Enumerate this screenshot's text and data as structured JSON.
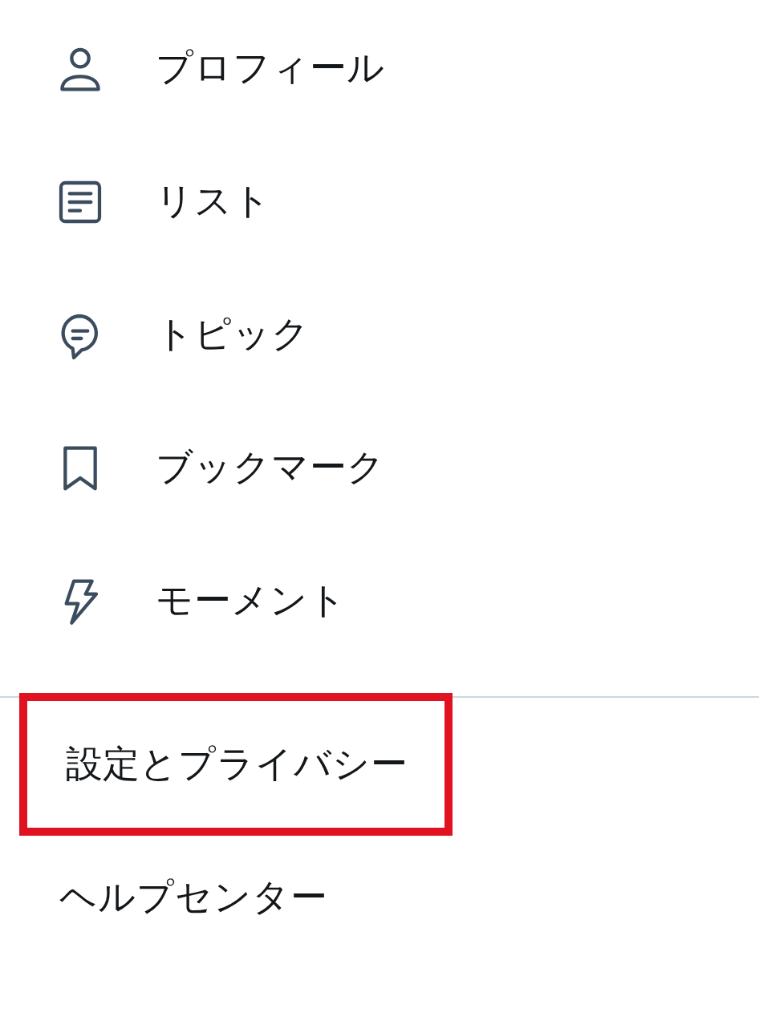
{
  "menu_items": [
    {
      "kind": "person",
      "label": "プロフィール"
    },
    {
      "kind": "list",
      "label": "リスト"
    },
    {
      "kind": "topic",
      "label": "トピック"
    },
    {
      "kind": "bookmark",
      "label": "ブックマーク"
    },
    {
      "kind": "bolt",
      "label": "モーメント"
    }
  ],
  "secondary_items": [
    {
      "label": "設定とプライバシー",
      "highlighted": true
    },
    {
      "label": "ヘルプセンター",
      "highlighted": false
    }
  ]
}
